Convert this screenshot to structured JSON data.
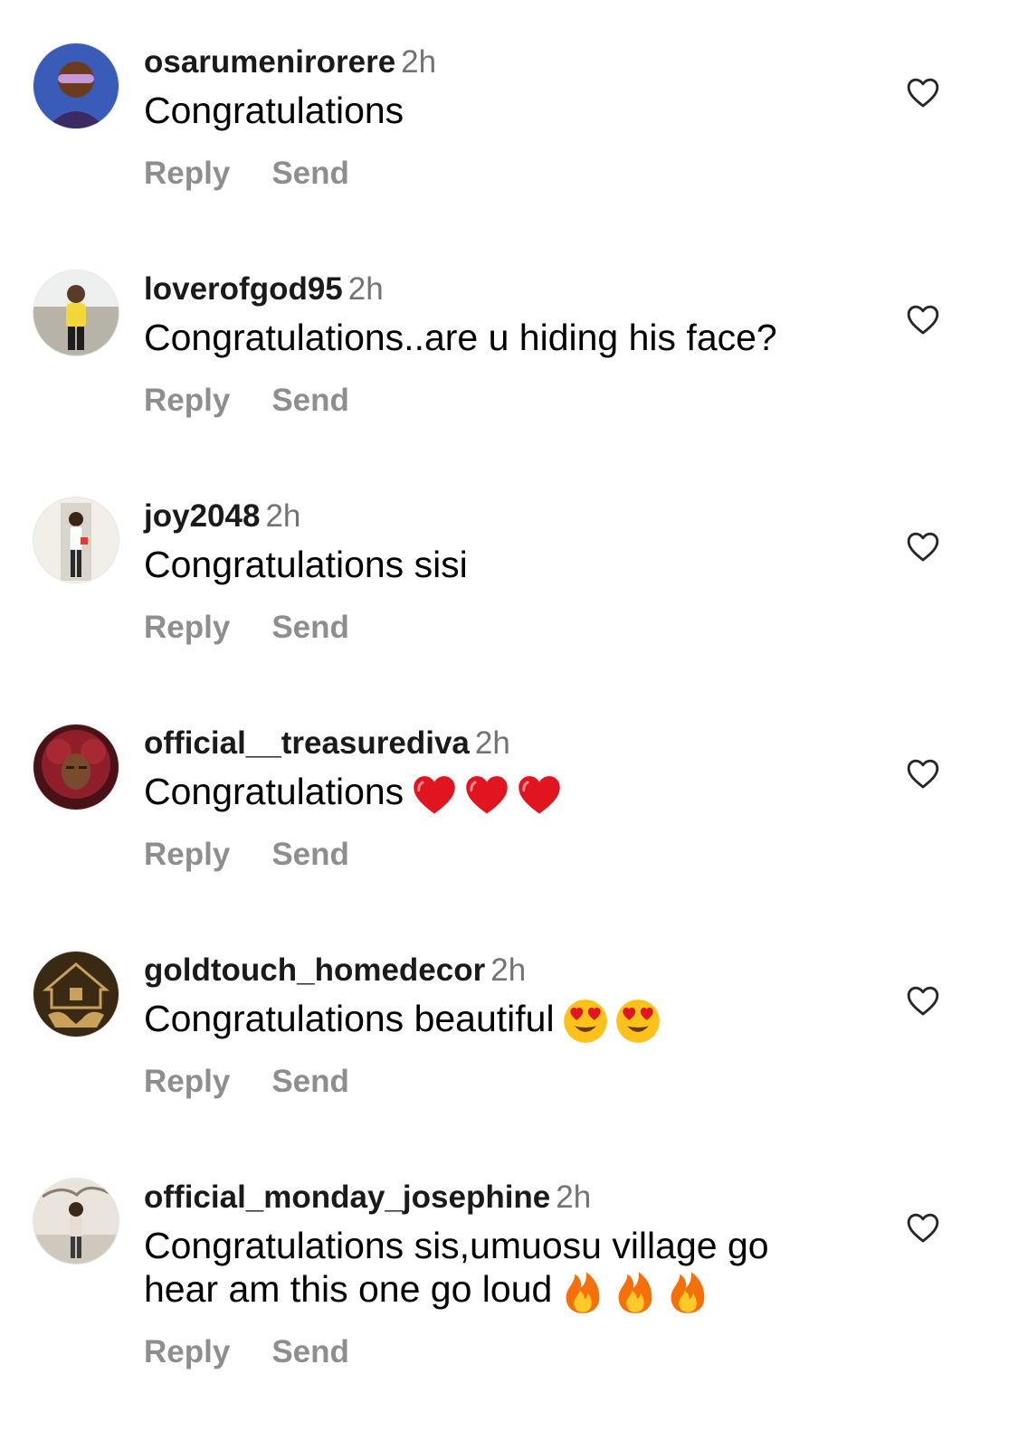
{
  "comments": [
    {
      "username": "osarumenirorere",
      "time": "2h",
      "text": "Congratulations",
      "emojis": [],
      "avatar_color": "#3b5bb8",
      "reply_label": "Reply",
      "send_label": "Send"
    },
    {
      "username": "loverofgod95",
      "time": "2h",
      "text": "Congratulations..are u hiding his face?",
      "emojis": [],
      "avatar_color": "#e9d44a",
      "reply_label": "Reply",
      "send_label": "Send"
    },
    {
      "username": "joy2048",
      "time": "2h",
      "text": "Congratulations sisi",
      "emojis": [],
      "avatar_color": "#d9d4cc",
      "reply_label": "Reply",
      "send_label": "Send"
    },
    {
      "username": "official__treasurediva",
      "time": "2h",
      "text": "Congratulations",
      "emojis": [
        "red-heart",
        "red-heart",
        "red-heart"
      ],
      "avatar_color": "#8e1f2a",
      "reply_label": "Reply",
      "send_label": "Send"
    },
    {
      "username": "goldtouch_homedecor",
      "time": "2h",
      "text": "Congratulations beautiful",
      "emojis": [
        "heart-eyes",
        "heart-eyes"
      ],
      "avatar_color": "#3a2a14",
      "reply_label": "Reply",
      "send_label": "Send"
    },
    {
      "username": "official_monday_josephine",
      "time": "2h",
      "text": "Congratulations sis,umuosu village go hear am this one go loud",
      "emojis": [
        "fire",
        "fire",
        "fire"
      ],
      "avatar_color": "#cfc8bd",
      "reply_label": "Reply",
      "send_label": "Send"
    }
  ],
  "colors": {
    "username": "#1a1a1a",
    "muted": "#8e8e8e",
    "heart_outline": "#262626"
  }
}
